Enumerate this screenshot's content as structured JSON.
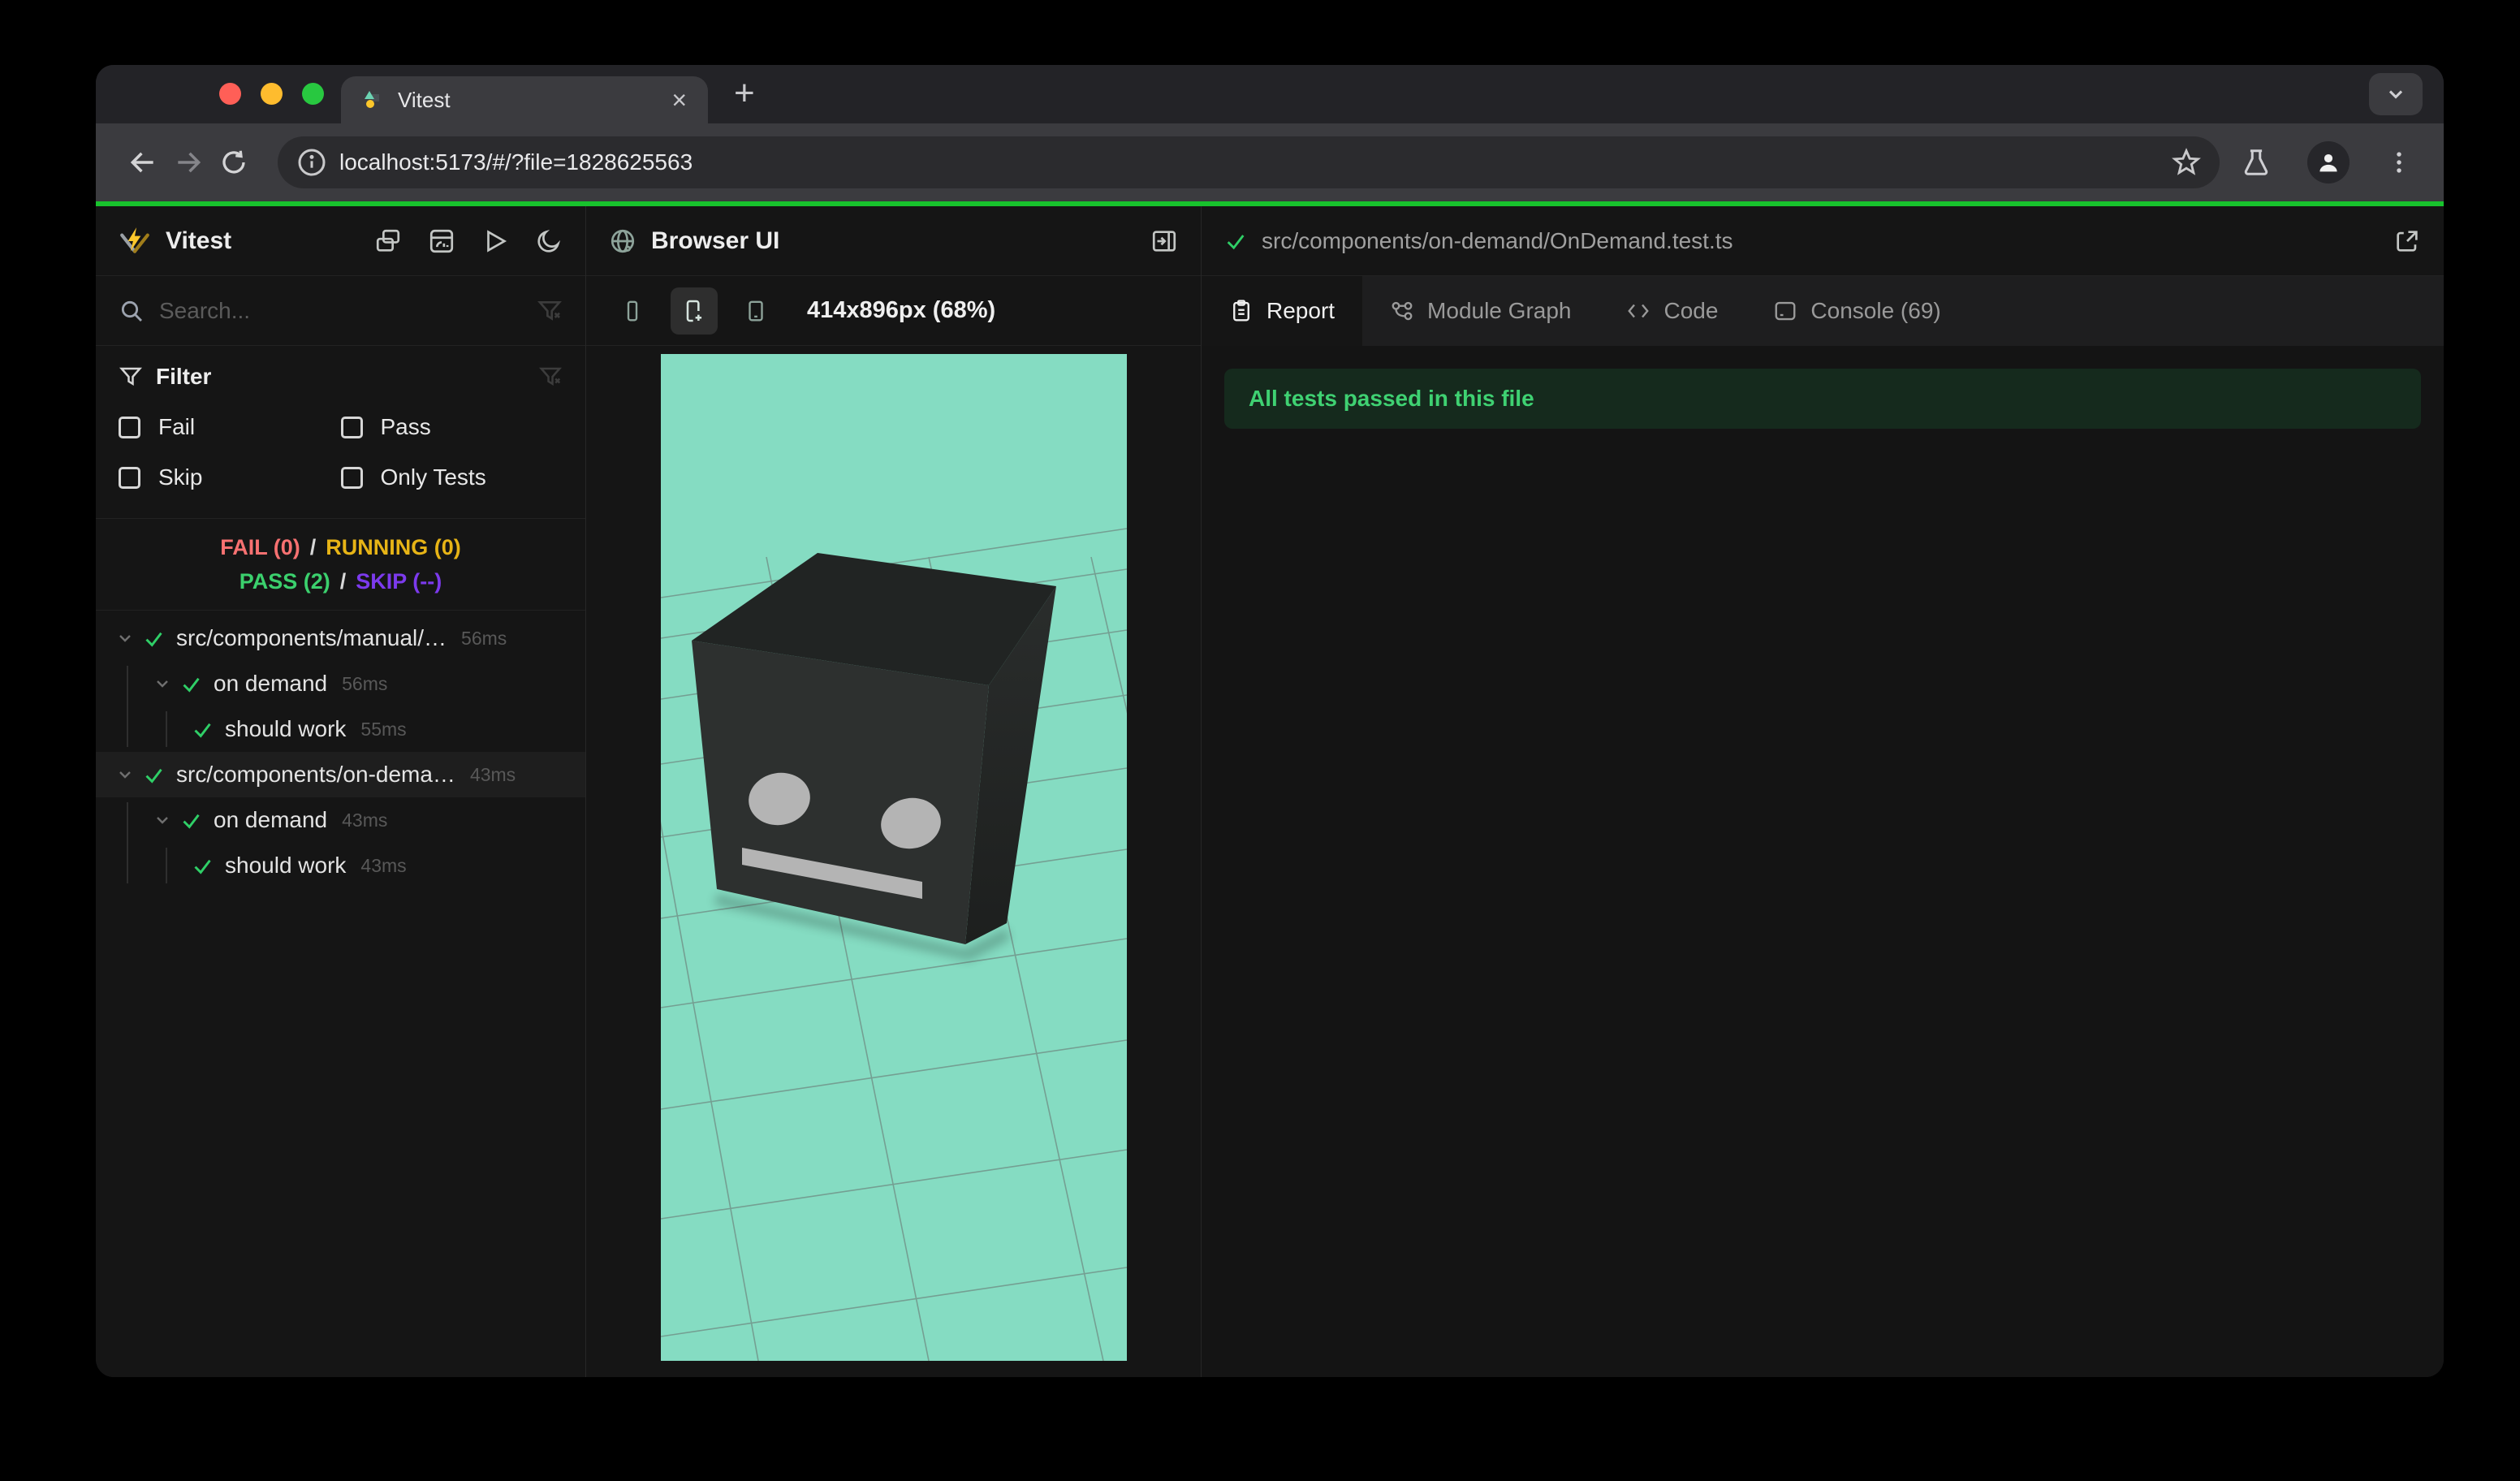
{
  "browser": {
    "tab": {
      "title": "Vitest"
    },
    "close_glyph": "×",
    "new_tab_glyph": "+",
    "url": "localhost:5173/#/?file=1828625563"
  },
  "sidebar": {
    "app_title": "Vitest",
    "search_placeholder": "Search...",
    "filter": {
      "title": "Filter",
      "options": [
        "Fail",
        "Pass",
        "Skip",
        "Only Tests"
      ]
    },
    "status": {
      "fail": "FAIL (0)",
      "running": "RUNNING (0)",
      "pass": "PASS (2)",
      "skip": "SKIP (--)",
      "separator": "/"
    },
    "tree": [
      {
        "label": "src/components/manual/…",
        "duration": "56ms"
      },
      {
        "label": "on demand",
        "duration": "56ms"
      },
      {
        "label": "should work",
        "duration": "55ms"
      },
      {
        "label": "src/components/on-dema…",
        "duration": "43ms"
      },
      {
        "label": "on demand",
        "duration": "43ms"
      },
      {
        "label": "should work",
        "duration": "43ms"
      }
    ]
  },
  "browser_panel": {
    "title": "Browser UI",
    "viewport_size": "414x896px (68%)"
  },
  "report_panel": {
    "file_path": "src/components/on-demand/OnDemand.test.ts",
    "tabs": [
      {
        "label": "Report"
      },
      {
        "label": "Module Graph"
      },
      {
        "label": "Code"
      },
      {
        "label": "Console (69)"
      }
    ],
    "banner": "All tests passed in this file"
  },
  "icons": [
    "back-icon",
    "forward-icon",
    "reload-icon",
    "info-icon",
    "star-icon",
    "flask-icon",
    "profile-icon",
    "kebab-menu-icon",
    "chevron-down-icon",
    "vitest-logo",
    "overlap-windows-icon",
    "dashboard-icon",
    "play-icon",
    "moon-icon",
    "search-icon",
    "funnel-icon",
    "funnel-x-icon",
    "checkbox",
    "pass-check-icon",
    "globe-icon",
    "panel-right-icon",
    "device-phone-icons",
    "clipboard-icon",
    "module-graph-icon",
    "code-icon",
    "console-icon",
    "external-link-icon"
  ],
  "colors": {
    "progress_bar": "#18c32d",
    "fail": "#f87171",
    "running": "#e7b416",
    "pass": "#3bd06d",
    "skip": "#7c3aed",
    "viewport_background": "#85dcc2",
    "banner_background": "#152a1d",
    "banner_text": "#3fd172"
  }
}
